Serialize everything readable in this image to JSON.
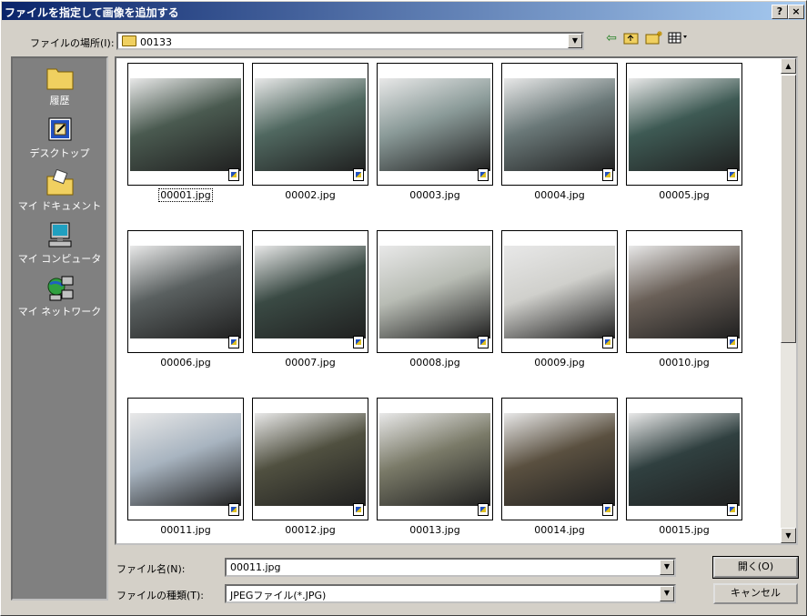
{
  "window": {
    "title": "ファイルを指定して画像を追加する",
    "help_label": "?",
    "close_label": "×"
  },
  "location": {
    "label": "ファイルの場所(I):",
    "value": "00133"
  },
  "toolbar": {
    "back_icon": "arrow-left-icon",
    "up_icon": "folder-up-icon",
    "new_icon": "new-folder-icon",
    "view_icon": "view-menu-icon"
  },
  "places": [
    {
      "label": "履歴",
      "icon": "history-folder-icon"
    },
    {
      "label": "デスクトップ",
      "icon": "desktop-icon"
    },
    {
      "label": "マイ ドキュメント",
      "icon": "my-documents-icon"
    },
    {
      "label": "マイ コンピュータ",
      "icon": "my-computer-icon"
    },
    {
      "label": "マイ ネットワーク",
      "icon": "my-network-icon"
    }
  ],
  "files": [
    {
      "name": "00001.jpg",
      "selected": true,
      "tone": "#4a5a50"
    },
    {
      "name": "00002.jpg",
      "tone": "#506860"
    },
    {
      "name": "00003.jpg",
      "tone": "#8a9a98"
    },
    {
      "name": "00004.jpg",
      "tone": "#6a7878"
    },
    {
      "name": "00005.jpg",
      "tone": "#3e5a54"
    },
    {
      "name": "00006.jpg",
      "tone": "#5a6060"
    },
    {
      "name": "00007.jpg",
      "tone": "#3a4a44"
    },
    {
      "name": "00008.jpg",
      "tone": "#b8bcb4"
    },
    {
      "name": "00009.jpg",
      "tone": "#d0d0cc"
    },
    {
      "name": "00010.jpg",
      "tone": "#6a6058"
    },
    {
      "name": "00011.jpg",
      "tone": "#a8b4c0"
    },
    {
      "name": "00012.jpg",
      "tone": "#505040"
    },
    {
      "name": "00013.jpg",
      "tone": "#7a7a68"
    },
    {
      "name": "00014.jpg",
      "tone": "#5a5040"
    },
    {
      "name": "00015.jpg",
      "tone": "#304040"
    }
  ],
  "filename": {
    "label": "ファイル名(N):",
    "value": "00011.jpg"
  },
  "filetype": {
    "label": "ファイルの種類(T):",
    "value": "JPEGファイル(*.JPG)"
  },
  "buttons": {
    "open": "開く(O)",
    "cancel": "キャンセル"
  }
}
